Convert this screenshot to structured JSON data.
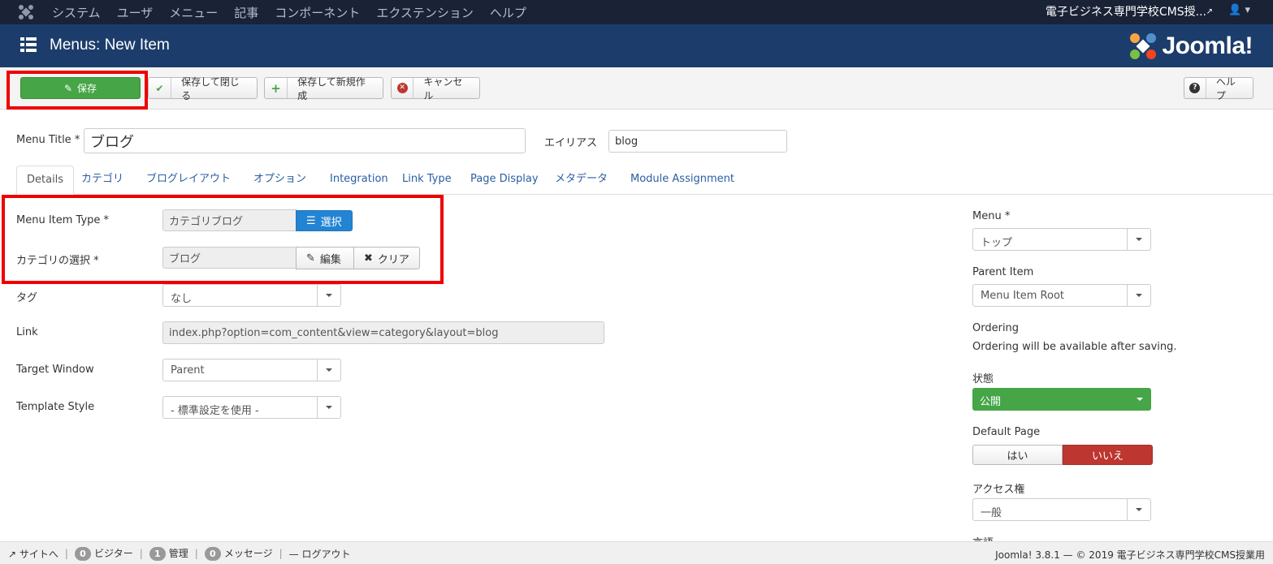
{
  "topnav": {
    "menu": [
      "システム",
      "ユーザ",
      "メニュー",
      "記事",
      "コンポーネント",
      "エクステンション",
      "ヘルプ"
    ],
    "site_name": "電子ビジネス専門学校CMS授..."
  },
  "header": {
    "title": "Menus: New Item",
    "brand": "Joomla!"
  },
  "toolbar": {
    "save": "保存",
    "save_close": "保存して閉じる",
    "save_new": "保存して新規作成",
    "cancel": "キャンセル",
    "help": "ヘルプ"
  },
  "form": {
    "menu_title_label": "Menu Title *",
    "menu_title_value": "ブログ",
    "alias_label": "エイリアス",
    "alias_value": "blog"
  },
  "tabs": [
    "Details",
    "カテゴリ",
    "ブログレイアウト",
    "オプション",
    "Integration",
    "Link Type",
    "Page Display",
    "メタデータ",
    "Module Assignment"
  ],
  "details": {
    "item_type_label": "Menu Item Type *",
    "item_type_value": "カテゴリブログ",
    "select_btn": "選択",
    "category_label": "カテゴリの選択 *",
    "category_value": "ブログ",
    "edit_btn": "編集",
    "clear_btn": "クリア",
    "tag_label": "タグ",
    "tag_value": "なし",
    "link_label": "Link",
    "link_value": "index.php?option=com_content&view=category&layout=blog",
    "target_label": "Target Window",
    "target_value": "Parent",
    "template_label": "Template Style",
    "template_value": "- 標準設定を使用 -"
  },
  "sidebar": {
    "menu_label": "Menu *",
    "menu_value": "トップ",
    "parent_label": "Parent Item",
    "parent_value": "Menu Item Root",
    "ordering_label": "Ordering",
    "ordering_note": "Ordering will be available after saving.",
    "status_label": "状態",
    "status_value": "公開",
    "default_label": "Default Page",
    "default_yes": "はい",
    "default_no": "いいえ",
    "access_label": "アクセス権",
    "access_value": "一般",
    "language_label": "言語"
  },
  "footer": {
    "site": "サイトへ",
    "visitors_count": "0",
    "visitors": "ビジター",
    "admin_count": "1",
    "admin": "管理",
    "messages_count": "0",
    "messages": "メッセージ",
    "logout": "ログアウト",
    "copyright": "Joomla! 3.8.1 — © 2019 電子ビジネス専門学校CMS授業用"
  },
  "colors": {
    "nav": "#1a2236",
    "header": "#1c3d6b",
    "save": "#46a546",
    "select_btn": "#2384d3",
    "no_active": "#bd362f",
    "highlight": "#e00000"
  }
}
